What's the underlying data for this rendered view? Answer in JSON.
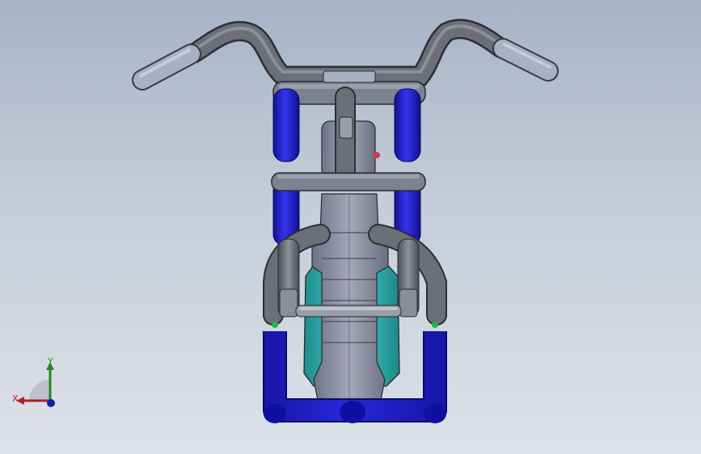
{
  "viewport": {
    "background_top": "#a6b3c6",
    "background_bottom": "#dde1e8"
  },
  "model": {
    "colors": {
      "frame_gray": "#6c6f78",
      "frame_gray_light": "#9a9ea8",
      "fork_blue": "#1e1ec8",
      "fork_blue_light": "#3c3cf0",
      "grip_gray": "#aab0c4",
      "tank_teal": "#2fb4b4",
      "body_gray": "#8e92a6",
      "edge_dark": "#2a2a30"
    }
  },
  "triad": {
    "x_label": "X",
    "y_label": "Y",
    "x_color": "#b02020",
    "y_color": "#1f8a1f",
    "z_color": "#1a1ab0"
  }
}
